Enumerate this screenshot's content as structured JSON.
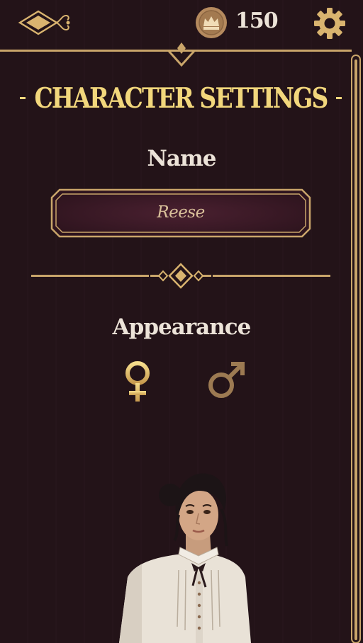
{
  "header": {
    "menu_icon": "ornate-diamond-menu-icon",
    "currency_icon": "crown-coin-icon",
    "currency_amount": "150",
    "settings_icon": "gear-icon"
  },
  "page": {
    "title": "CHARACTER SETTINGS"
  },
  "name_section": {
    "label": "Name",
    "value": "Reese"
  },
  "appearance_section": {
    "label": "Appearance",
    "options": [
      {
        "icon": "female-symbol-icon",
        "selected": true
      },
      {
        "icon": "male-symbol-icon",
        "selected": false
      }
    ]
  },
  "character": {
    "portrait_icon": "character-portrait"
  },
  "colors": {
    "background": "#231318",
    "gold": "#c9a56a",
    "title_gold": "#f2d77c",
    "text_light": "#ece3d8",
    "field_fill": "#3b1a26"
  }
}
